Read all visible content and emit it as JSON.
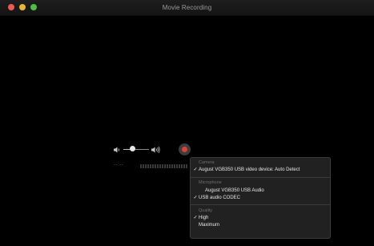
{
  "window": {
    "title": "Movie Recording"
  },
  "controls": {
    "volume_level": 0.35,
    "time_label": "--:--"
  },
  "menu": {
    "sections": [
      {
        "header": "Camera",
        "items": [
          {
            "label": "August VGB350 USB video device: Auto Detect",
            "checked": true
          }
        ]
      },
      {
        "header": "Microphone",
        "items": [
          {
            "label": "August VGB350 USB Audio",
            "checked": false
          },
          {
            "label": "USB audio CODEC",
            "checked": true
          }
        ]
      },
      {
        "header": "Quality",
        "items": [
          {
            "label": "High",
            "checked": true
          },
          {
            "label": "Maximum",
            "checked": false
          }
        ]
      }
    ],
    "check_glyph": "✓"
  },
  "colors": {
    "record": "#d7433a",
    "close": "#ee5a52",
    "minimize": "#e8b530",
    "maximize": "#4dc043"
  }
}
